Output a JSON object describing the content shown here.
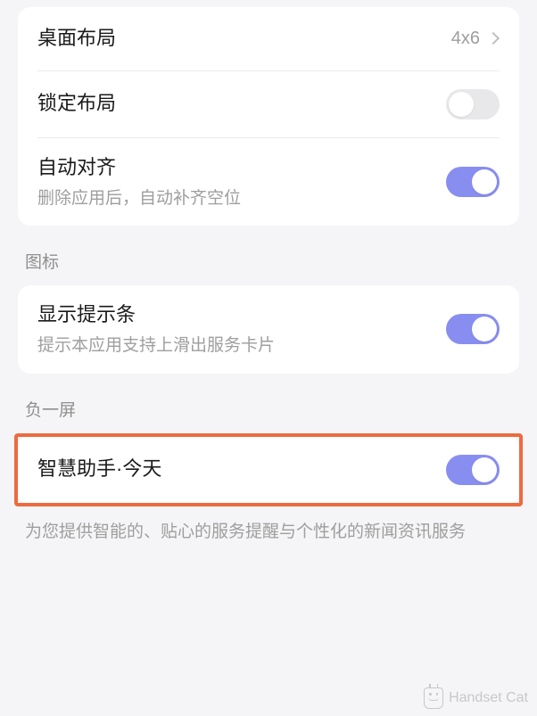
{
  "layout_group": {
    "desktop_layout": {
      "label": "桌面布局",
      "value": "4x6"
    },
    "lock_layout": {
      "label": "锁定布局",
      "on": false
    },
    "auto_align": {
      "label": "自动对齐",
      "subtitle": "删除应用后，自动补齐空位",
      "on": true
    }
  },
  "icon_section": {
    "header": "图标",
    "hint_bar": {
      "label": "显示提示条",
      "subtitle": "提示本应用支持上滑出服务卡片",
      "on": true
    }
  },
  "minus_one_section": {
    "header": "负一屏",
    "assistant": {
      "label": "智慧助手·今天",
      "on": true
    },
    "footer": "为您提供智能的、贴心的服务提醒与个性化的新闻资讯服务"
  },
  "watermark": "Handset Cat"
}
